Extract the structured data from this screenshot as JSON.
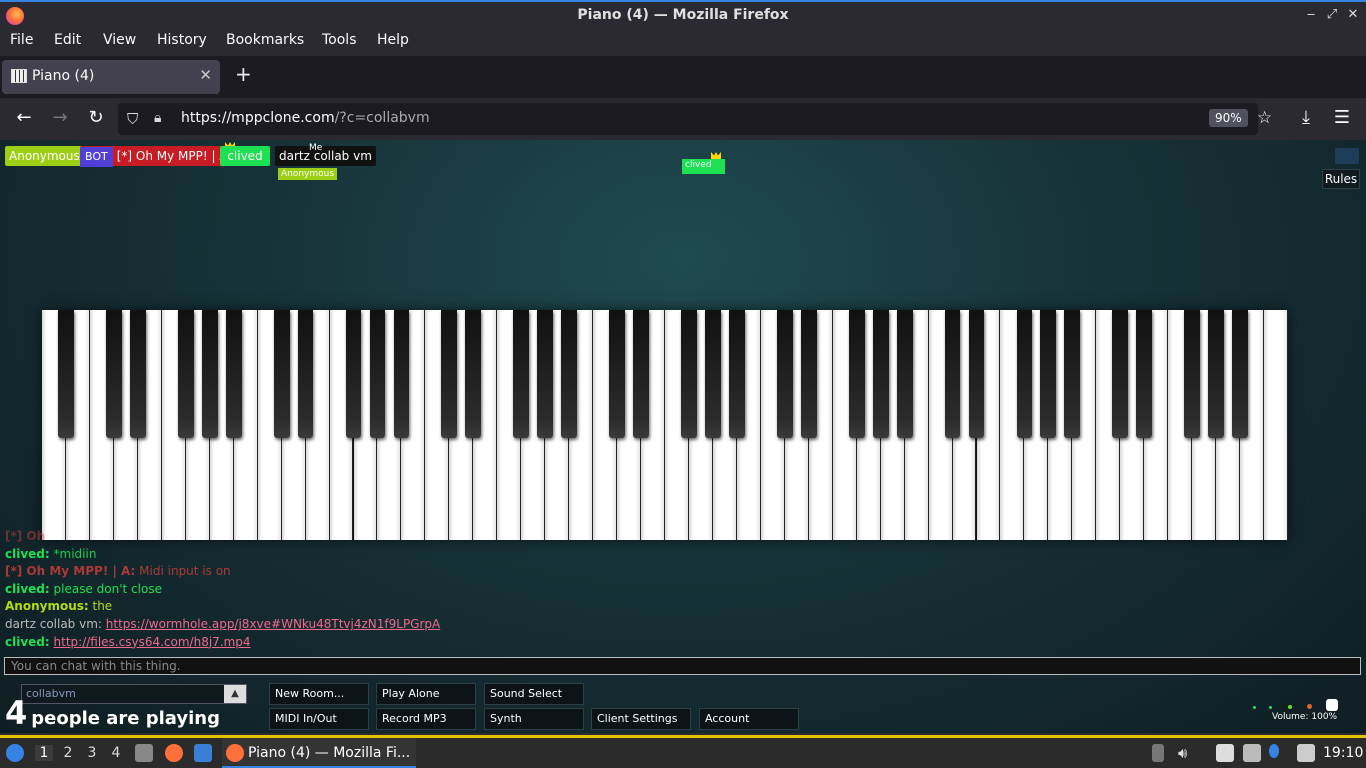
{
  "window": {
    "title": "Piano (4) — Mozilla Firefox"
  },
  "menu": [
    "File",
    "Edit",
    "View",
    "History",
    "Bookmarks",
    "Tools",
    "Help"
  ],
  "tab": {
    "label": "Piano (4)"
  },
  "url": {
    "host": "https://mppclone.com",
    "path": "/?c=collabvm",
    "zoom": "90%"
  },
  "players": {
    "anonymous": "Anonymous",
    "bot_tag": "BOT",
    "bot_name": "[*] Oh My MPP! | A",
    "clived": "clived",
    "dartz": "dartz collab vm",
    "me_tag": "Me",
    "anon_cursor": "Anonymous",
    "clived_cursor": "clived"
  },
  "rules": "Rules",
  "chat": [
    {
      "name": "[*] Oh",
      "text": "",
      "color": "#e0403c",
      "faded": true
    },
    {
      "name": "clived:",
      "text": "*midiin",
      "color": "#1de052"
    },
    {
      "name": "[*] Oh My MPP! | A:",
      "text": "Midi input is on",
      "color": "#e0403c"
    },
    {
      "name": "clived:",
      "text": "please don't close",
      "color": "#1de052"
    },
    {
      "name": "Anonymous:",
      "text": "the",
      "color": "#b2dc14"
    },
    {
      "name": "dartz collab vm:",
      "link": "https://wormhole.app/j8xve#WNku48Ttvj4zN1f9LPGrpA",
      "color": "#bbbbbb"
    },
    {
      "name": "clived:",
      "link": "http://files.csys64.com/h8j7.mp4",
      "color": "#1de052"
    }
  ],
  "chat_placeholder": "You can chat with this thing.",
  "room": "collabvm",
  "count": {
    "number": "4",
    "text": "people are playing"
  },
  "buttons": {
    "new_room": "New Room...",
    "play_alone": "Play Alone",
    "sound_select": "Sound Select",
    "midi": "MIDI In/Out",
    "record": "Record MP3",
    "synth": "Synth",
    "client_settings": "Client Settings",
    "account": "Account"
  },
  "volume": "Volume: 100%",
  "taskbar": {
    "workspaces": [
      "1",
      "2",
      "3",
      "4"
    ],
    "app": "Piano (4) — Mozilla Fi...",
    "clock": "19:10"
  }
}
